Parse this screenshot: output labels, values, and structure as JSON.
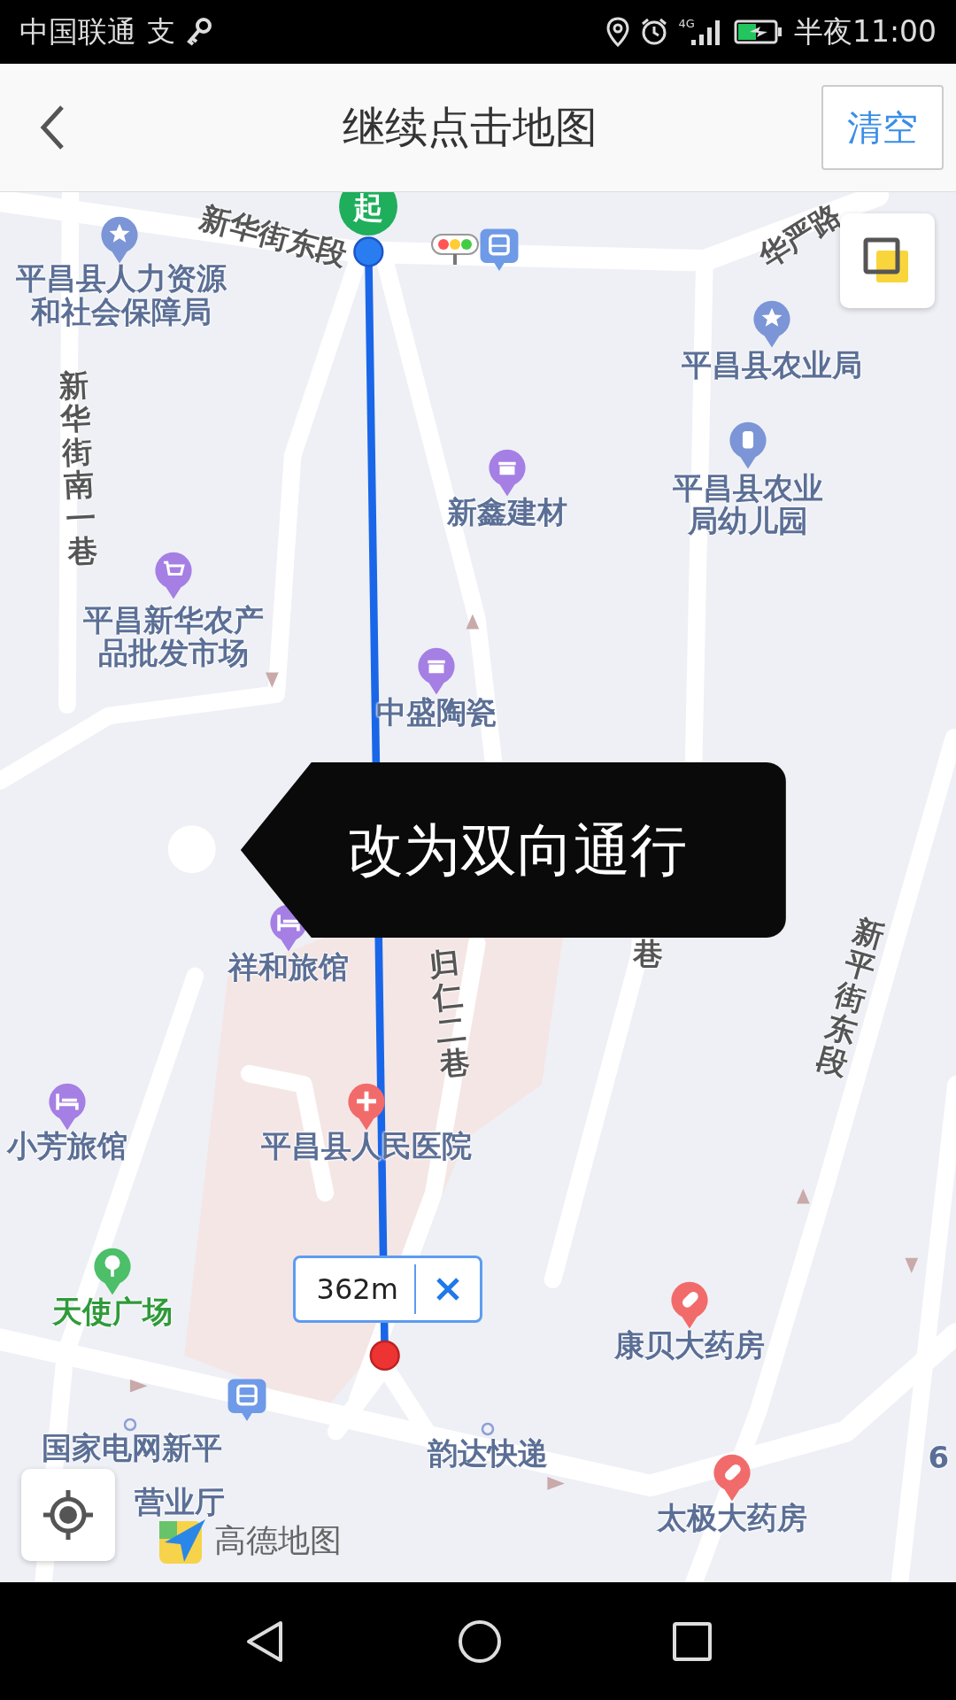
{
  "status_bar": {
    "carrier": "中国联通",
    "notification": "支",
    "network": "4G",
    "time": "半夜11:00"
  },
  "header": {
    "title": "继续点击地图",
    "clear_button": "清空"
  },
  "map": {
    "start_marker": "起",
    "pois": [
      {
        "name": "平昌县人力资源和社会保障局",
        "kind": "star",
        "color": "#7c95d6"
      },
      {
        "name": "平昌县农业局",
        "kind": "star",
        "color": "#7c95d6"
      },
      {
        "name": "新鑫建材",
        "kind": "shop",
        "color": "#a57fe4"
      },
      {
        "name": "平昌县农业局幼儿园",
        "kind": "bottle",
        "color": "#7c95d6"
      },
      {
        "name": "平昌新华农产品批发市场",
        "kind": "cart",
        "color": "#a57fe4"
      },
      {
        "name": "中盛陶瓷",
        "kind": "shop",
        "color": "#a57fe4"
      },
      {
        "name": "祥和旅馆",
        "kind": "bed",
        "color": "#a57fe4"
      },
      {
        "name": "小芳旅馆",
        "kind": "bed",
        "color": "#a57fe4"
      },
      {
        "name": "平昌县人民医院",
        "kind": "plus",
        "color": "#f26b6b"
      },
      {
        "name": "天使广场",
        "kind": "tree",
        "color": "#4cbf68"
      },
      {
        "name": "康贝大药房",
        "kind": "pill",
        "color": "#f26b6b"
      },
      {
        "name": "韵达快递",
        "kind": "dot",
        "color": "#8d9fd6"
      },
      {
        "name": "太极大药房",
        "kind": "pill",
        "color": "#f26b6b"
      },
      {
        "name": "国家电网新平",
        "kind": "dot",
        "color": "#8d9fd6"
      },
      {
        "name": "营业厅",
        "kind": "text"
      },
      {
        "name": "6",
        "kind": "text"
      }
    ],
    "road_labels": [
      "新华街东段",
      "华严路",
      "新华街南一巷",
      "归仁二巷",
      "巷",
      "新平街东段"
    ],
    "distance_bubble": {
      "distance": "362m"
    },
    "toast": "改为双向通行",
    "logo": "高德地图"
  }
}
